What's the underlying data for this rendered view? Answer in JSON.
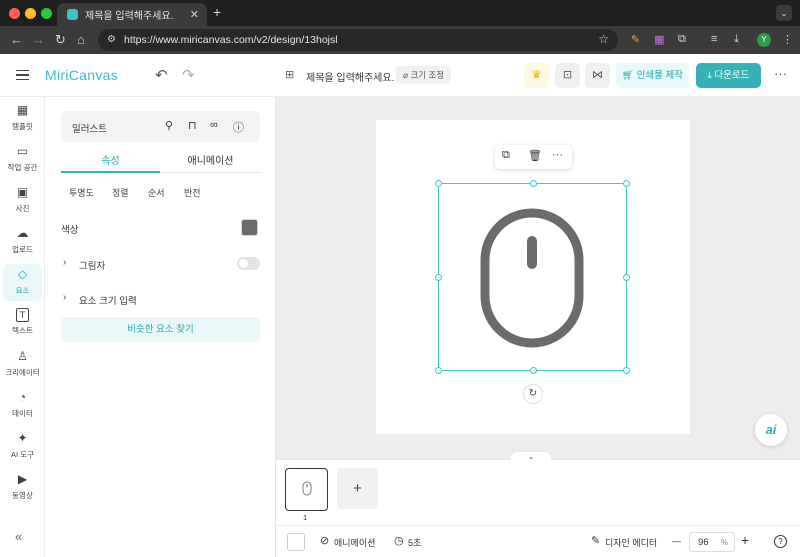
{
  "browser": {
    "tab_title": "제목을 입력해주세요.",
    "tab_close": "✕",
    "new_tab": "+",
    "url": "https://www.miricanvas.com/v2/design/13hojsl",
    "profile_initial": "Y"
  },
  "header": {
    "logo": "MiriCanvas",
    "doc_title": "제목을 입력해주세요.",
    "resize_label": "크기 조정",
    "print_label": "인쇄물 제작",
    "download_label": "다운로드",
    "more": "···"
  },
  "rail": {
    "items": [
      {
        "label": "템플릿",
        "icon": "▦"
      },
      {
        "label": "작업 공간",
        "icon": "▭"
      },
      {
        "label": "사진",
        "icon": "▣"
      },
      {
        "label": "업로드",
        "icon": "☁"
      },
      {
        "label": "요소",
        "icon": "◇"
      },
      {
        "label": "텍스트",
        "icon": "T"
      },
      {
        "label": "크리에이터",
        "icon": "♙"
      },
      {
        "label": "데이터",
        "icon": "◔"
      },
      {
        "label": "AI 도구",
        "icon": "✦"
      },
      {
        "label": "동영상",
        "icon": "▶"
      }
    ],
    "collapse": "«"
  },
  "panel": {
    "element_name": "일러스트",
    "tabs": [
      "속성",
      "애니메이션"
    ],
    "sub_options": [
      "투명도",
      "정렬",
      "순서",
      "반전"
    ],
    "color_label": "색상",
    "shadow_label": "그림자",
    "size_label": "요소 크기 입력",
    "similar_button": "비슷한 요소 찾기"
  },
  "canvas": {
    "illustration_color": "#6b6b6b",
    "selection_color": "#3ec8cf",
    "ai_label": "ai"
  },
  "pages": {
    "current": "1",
    "add": "+"
  },
  "bottombar": {
    "animation_label": "애니메이션",
    "duration_label": "5초",
    "designer_editor_label": "디자인 에디터",
    "zoom_value": "96",
    "zoom_unit": "%",
    "minus": "—",
    "plus": "+",
    "help": "?"
  }
}
